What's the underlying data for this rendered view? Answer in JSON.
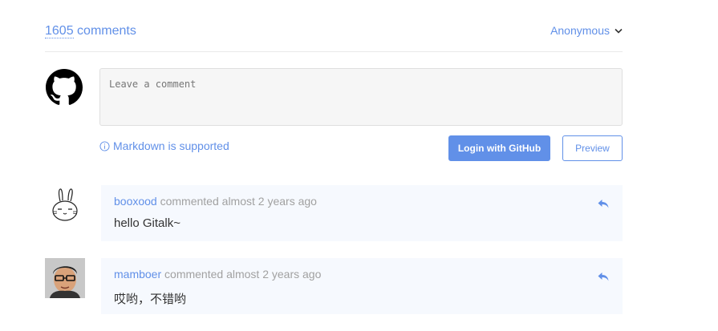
{
  "header": {
    "comment_count": "1605",
    "comment_label": " comments",
    "user": "Anonymous"
  },
  "form": {
    "placeholder": "Leave a comment",
    "markdown_tip": "Markdown is supported",
    "login_button": "Login with GitHub",
    "preview_button": "Preview"
  },
  "comments": [
    {
      "author": "booxood",
      "action": "commented",
      "time": "almost 2 years ago",
      "body": "hello Gitalk~"
    },
    {
      "author": "mamboer",
      "action": "commented",
      "time": "almost 2 years ago",
      "body": "哎哟，不错哟"
    }
  ],
  "colors": {
    "accent": "#6190e8",
    "comment_bg": "#f6f9fe"
  }
}
